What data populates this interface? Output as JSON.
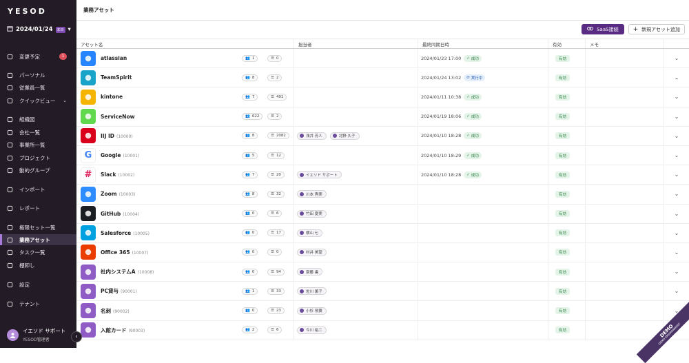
{
  "sidebar": {
    "logo": "YESOD",
    "date": "2024/01/24",
    "date_badge": "本日",
    "items": [
      {
        "label": "変更予定",
        "icon": "clipboard-icon",
        "badge": "1"
      },
      {
        "label": "パーソナル",
        "icon": "person-icon"
      },
      {
        "label": "従業員一覧",
        "icon": "people-icon"
      },
      {
        "label": "クイックビュー",
        "icon": "search-icon"
      },
      {
        "label": "組織図",
        "icon": "org-chart-icon"
      },
      {
        "label": "会社一覧",
        "icon": "building-icon"
      },
      {
        "label": "事業所一覧",
        "icon": "office-icon"
      },
      {
        "label": "プロジェクト",
        "icon": "project-icon"
      },
      {
        "label": "動的グループ",
        "icon": "filter-icon"
      },
      {
        "label": "インポート",
        "icon": "import-icon"
      },
      {
        "label": "レポート",
        "icon": "report-icon"
      },
      {
        "label": "権限セット一覧",
        "icon": "grid-icon"
      },
      {
        "label": "業務アセット",
        "icon": "link-icon"
      },
      {
        "label": "タスク一覧",
        "icon": "tasks-icon"
      },
      {
        "label": "棚卸し",
        "icon": "cloud-icon"
      },
      {
        "label": "設定",
        "icon": "gear-icon"
      },
      {
        "label": "テナント",
        "icon": "tenant-icon"
      }
    ],
    "user": {
      "name": "イエソド サポート",
      "role": "YESOD管理者"
    }
  },
  "header": {
    "title": "業務アセット"
  },
  "toolbar": {
    "saas_label": "SaaS接続",
    "add_label": "新規アセット追加"
  },
  "table": {
    "columns": [
      "アセット名",
      "担当者",
      "最終同期日時",
      "有効",
      "メモ"
    ],
    "rows": [
      {
        "name": "atlassian",
        "id": "",
        "icon": "atlassian-icon",
        "color": "#2684ff",
        "users": "1",
        "items": "0",
        "owners": [],
        "sync": "2024/01/23 17:00",
        "status": "成功",
        "status_type": "ok",
        "valid": "有効"
      },
      {
        "name": "TeamSpirit",
        "id": "",
        "icon": "teamspirit-icon",
        "color": "#1aa3c8",
        "users": "8",
        "items": "2",
        "owners": [],
        "sync": "2024/01/24 13:02",
        "status": "実行中",
        "status_type": "run",
        "valid": "有効"
      },
      {
        "name": "kintone",
        "id": "",
        "icon": "kintone-icon",
        "color": "#f5b400",
        "users": "7",
        "items": "491",
        "owners": [],
        "sync": "2024/01/11 10:38",
        "status": "成功",
        "status_type": "ok",
        "valid": "有効"
      },
      {
        "name": "ServiceNow",
        "id": "",
        "icon": "servicenow-icon",
        "color": "#62d84e",
        "users": "622",
        "items": "2",
        "owners": [],
        "sync": "2024/01/19 18:06",
        "status": "成功",
        "status_type": "ok",
        "valid": "有効"
      },
      {
        "name": "IIJ ID",
        "id": "(10000)",
        "icon": "iij-icon",
        "color": "#d9001b",
        "users": "8",
        "items": "2082",
        "owners": [
          "浅井 芳人",
          "北野 久子"
        ],
        "sync": "2024/01/10 18:28",
        "status": "成功",
        "status_type": "ok",
        "valid": "有効"
      },
      {
        "name": "Google",
        "id": "(10001)",
        "icon": "google-icon",
        "color": "#ffffff",
        "users": "5",
        "items": "12",
        "owners": [],
        "sync": "2024/01/10 18:29",
        "status": "成功",
        "status_type": "ok",
        "valid": "有効"
      },
      {
        "name": "Slack",
        "id": "(10002)",
        "icon": "slack-icon",
        "color": "#ffffff",
        "users": "7",
        "items": "20",
        "owners": [
          "イエソド サポート"
        ],
        "sync": "2024/01/10 18:28",
        "status": "成功",
        "status_type": "ok",
        "valid": "有効"
      },
      {
        "name": "Zoom",
        "id": "(10003)",
        "icon": "zoom-icon",
        "color": "#2d8cff",
        "users": "8",
        "items": "32",
        "owners": [
          "川本 秀実"
        ],
        "sync": "",
        "status": "",
        "status_type": "",
        "valid": "有効"
      },
      {
        "name": "GitHub",
        "id": "(10004)",
        "icon": "github-icon",
        "color": "#1b1f23",
        "users": "0",
        "items": "6",
        "owners": [
          "竹田 夏実"
        ],
        "sync": "",
        "status": "",
        "status_type": "",
        "valid": "有効"
      },
      {
        "name": "Salesforce",
        "id": "(10005)",
        "icon": "salesforce-icon",
        "color": "#00a1e0",
        "users": "0",
        "items": "17",
        "owners": [
          "横山 七"
        ],
        "sync": "",
        "status": "",
        "status_type": "",
        "valid": "有効"
      },
      {
        "name": "Office 365",
        "id": "(10007)",
        "icon": "office-icon",
        "color": "#eb3c00",
        "users": "0",
        "items": "0",
        "owners": [
          "村井 美望"
        ],
        "sync": "",
        "status": "",
        "status_type": "",
        "valid": "有効"
      },
      {
        "name": "社内システムA",
        "id": "(10008)",
        "icon": "building-icon",
        "color": "#8e5cc4",
        "users": "0",
        "items": "94",
        "owners": [
          "齋藤 書"
        ],
        "sync": "",
        "status": "",
        "status_type": "",
        "valid": "有効"
      },
      {
        "name": "PC貸与",
        "id": "(90001)",
        "icon": "laptop-icon",
        "color": "#8e5cc4",
        "users": "1",
        "items": "33",
        "owners": [
          "佐川 薫子"
        ],
        "sync": "",
        "status": "",
        "status_type": "",
        "valid": "有効"
      },
      {
        "name": "名刺",
        "id": "(90002)",
        "icon": "card-icon",
        "color": "#8e5cc4",
        "users": "0",
        "items": "23",
        "owners": [
          "小杉 飛翼"
        ],
        "sync": "",
        "status": "",
        "status_type": "",
        "valid": "有効"
      },
      {
        "name": "入館カード",
        "id": "(90003)",
        "icon": "badge-icon",
        "color": "#8e5cc4",
        "users": "2",
        "items": "6",
        "owners": [
          "今川 裕二"
        ],
        "sync": "",
        "status": "",
        "status_type": "",
        "valid": "有効"
      }
    ]
  },
  "demo_ribbon": {
    "label": "DEMO",
    "sub": "DEMO ENVIRONMENT"
  }
}
